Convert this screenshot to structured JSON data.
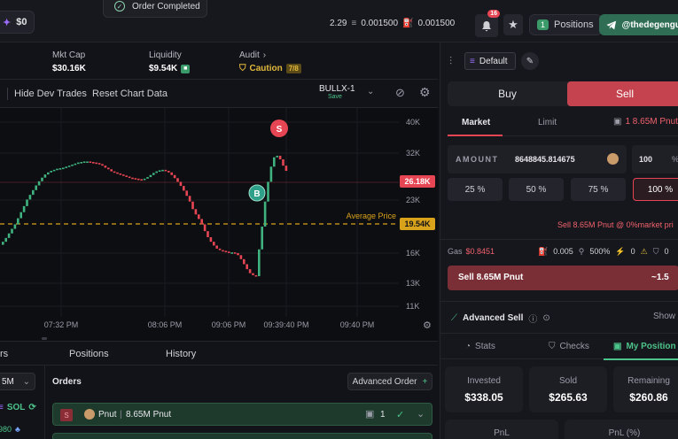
{
  "topbar": {
    "balance": "$0",
    "stat_a": "2.29",
    "stat_b": "0.001500",
    "stat_c": "0.001500",
    "notif_count": "16",
    "positions_count": "1",
    "positions_label": "Positions",
    "telegram_label": "@thedegengu"
  },
  "toast": {
    "text": "Order Completed"
  },
  "token_stats": {
    "mktcap_label": "Mkt Cap",
    "mktcap_value": "$30.16K",
    "liquidity_label": "Liquidity",
    "liquidity_value": "$9.54K",
    "audit_label": "Audit",
    "audit_chevron": "›",
    "audit_value": "Caution",
    "audit_score": "7/8"
  },
  "chart_toolbar": {
    "hide_dev": "Hide Dev Trades",
    "reset": "Reset Chart Data",
    "bot_name": "BULLX-1",
    "bot_status": "Save"
  },
  "chart_data": {
    "type": "candlestick",
    "y_ticks": [
      "40K",
      "32K",
      "23K",
      "16K",
      "13K",
      "11K"
    ],
    "x_ticks": [
      "07:32 PM",
      "08:06 PM",
      "09:06 PM",
      "09:39:40 PM",
      "09:40 PM"
    ],
    "current_price_label": "26.18K",
    "average_price_text": "Average Price",
    "average_price_label": "19.54K",
    "buy_marker": "B",
    "sell_marker": "S",
    "close_series": [
      17.5,
      18,
      18.6,
      19.2,
      19.8,
      20.6,
      21.4,
      22.2,
      23.1,
      24,
      24.9,
      25.8,
      26.6,
      27.3,
      27.9,
      28.3,
      28.6,
      28.8,
      29,
      29.1,
      29.2,
      29.4,
      29.6,
      29.8,
      30,
      30.2,
      30.3,
      30.4,
      30.4,
      30.3,
      30.2,
      30.1,
      29.9,
      29.6,
      29.2,
      28.9,
      28.5,
      28.3,
      28.1,
      27.9,
      27.7,
      27.5,
      27.3,
      27.2,
      27.1,
      27,
      26.9,
      27.1,
      27.4,
      27.8,
      28.2,
      28.5,
      28.7,
      28.8,
      28.6,
      28.3,
      27.8,
      27.2,
      26.5,
      25.7,
      24.8,
      23.8,
      22.8,
      21.8,
      21.1,
      20.5,
      19.8,
      18.9,
      18.1,
      17.5,
      17,
      16.6,
      16.4,
      16.3,
      16.2,
      16.1,
      16.1,
      16,
      15.8,
      15.4,
      14.9,
      14.4,
      14,
      13.8,
      13.7,
      16.5,
      19.5,
      22.8,
      26.5,
      29.4,
      31.2,
      31.5,
      30.8,
      29.6,
      28.6
    ]
  },
  "bottom_tabs": {
    "t1": "rs",
    "t2": "Positions",
    "t3": "History"
  },
  "orders": {
    "title": "Orders",
    "filter": "5M",
    "sol_label": "SOL",
    "left_num": "980",
    "advanced_order": "Advanced Order",
    "row_side": "S",
    "row_token": "Pnut",
    "row_amount": "8.65M Pnut",
    "row_count": "1"
  },
  "panel": {
    "preset": "Default",
    "buy": "Buy",
    "sell": "Sell",
    "tab_market": "Market",
    "tab_limit": "Limit",
    "holding": "1  8.65M Pnut",
    "amount_label": "AMOUNT",
    "amount_value": "8648845.814675",
    "slip_value": "100",
    "slip_unit": "%",
    "p25": "25 %",
    "p50": "50 %",
    "p75": "75 %",
    "p100": "100 %",
    "summary": "Sell 8.65M Pnut @ 0%market pri",
    "gas_label": "Gas",
    "gas_value": "$0.8451",
    "fee1": "0.005",
    "fee2": "500%",
    "fee3": "0",
    "fee4": "0",
    "sell_button": "Sell 8.65M Pnut",
    "sell_button_right": "~1.5",
    "advanced_sell": "Advanced Sell",
    "show": "Show",
    "tab_stats": "Stats",
    "tab_checks": "Checks",
    "tab_position": "My Position",
    "invested_label": "Invested",
    "invested_value": "$338.05",
    "sold_label": "Sold",
    "sold_value": "$265.63",
    "remaining_label": "Remaining",
    "remaining_value": "$260.86",
    "pnl_label": "PnL",
    "pnl_pct_label": "PnL (%)"
  },
  "colors": {
    "green": "#4cc38a",
    "red": "#f0616d",
    "accent": "#9b6bff",
    "avg_line": "#d9a21b"
  }
}
